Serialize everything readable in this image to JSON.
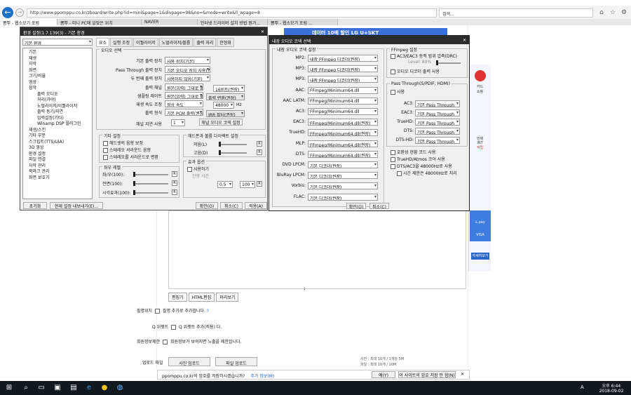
{
  "browser": {
    "url": "http://www.ppomppu.co.kr/zboard/write.php?id=mini&page=1&divpage=98&no=&mode=write&ll_wpage=8",
    "search": "검색...",
    "tabs": [
      "뽐뿌 - 웹소모기 포럼",
      "뽐뿌 - 미니 PC에 알맞은 위치",
      "NAVER",
      "인터넷 드라이버 설치 방법 뭔가...",
      "뽐뿌 - 웹소모기 포럼 ..."
    ]
  },
  "ad_top": "데이터 10배 할인 LG U+SKT",
  "editor_tabs": [
    "편집기",
    "HTML편집",
    "미리보기"
  ],
  "form": {
    "name_label": "필명위치",
    "name_check": "필명 추가로 추가합니다.",
    "help": "?",
    "chk_label": "Q 위젯트",
    "chk_text": "Q 위젯트 추가(적용) 다.",
    "anon_label": "회원정보제한",
    "anon_text": "회원정보가 보여지면 노출을 제한합니다.",
    "file_label": "업로드 파일",
    "file_btn1": "사진 업로드",
    "file_btn2": "파일 업로드",
    "quota1": "사진 : 최대 10개 / 1개당 5M",
    "quota2": "파일 : 최대 10개 / 10M"
  },
  "sidead": {
    "line1": "카드",
    "line2": "쇼핑",
    "line3": "언제",
    "line4": "INT",
    "line5": "적립",
    "lpay": "L.pay",
    "visa": "VISA",
    "detail": "자세히보기 >"
  },
  "main_dialog": {
    "title": "환경 설정(1.7.139(3) - 기본 환경",
    "tree_select": "기본 환경",
    "tree": [
      "기본",
      "재생",
      "자막",
      "화면",
      "크기/비율",
      "영상",
      "음악",
      "출력 오디오",
      "처리(가야)",
      "노멀라이저/이퀄라이저",
      "출력 동기/지연",
      "입력설정(기타)",
      "Winamp DSP 플러그인",
      "재생/스킨",
      "기타 부분",
      "스크립트(TTS/UIA)",
      "3D 영상",
      "환경 설정",
      "파일 연결",
      "자막 관리",
      "북마크 관리",
      "화면 보호기"
    ],
    "tabs": [
      "요소",
      "실행 조정",
      "이퀄라이저",
      "노멀라이저/볼륨",
      "출력 처리",
      "안정화"
    ],
    "g1": "오디오 선택",
    "rows": [
      {
        "l": "기본 출력 장치",
        "v": "사용 장치(기본)"
      },
      {
        "l": "Pass Through 출력 장치",
        "v": "기본 오디오 장치 사용(권장)"
      },
      {
        "l": "두 번째 출력 장치",
        "v": "사용하지 않음(기본)"
      },
      {
        "l": "출력 채널",
        "v": "원본(입력) 그대로 출력"
      },
      {
        "l": "샘플링 레이트",
        "v": "원본(입력) 그대로 출력"
      },
      {
        "l": "재생 속도 조정",
        "v": "정상 속도"
      },
      {
        "l": "출력 형식",
        "v": "기본 PCM 출력(권장)"
      }
    ],
    "bits": "16비트(권장)",
    "rate_extra": "48000",
    "ch_extra": "출력 변환(권장)",
    "play_extra": "IRR 필터(권장)",
    "delay_label": "채널 지연 사용",
    "delay_val": "1",
    "delay_btn": "채널 오디오 코덱 설정",
    "g2": "기타 설정",
    "g2_items": [
      "헤드셋의 음향 보정",
      "스테레오 서라운드 음향",
      "스테레오를 서라운드로 변환"
    ],
    "g3": "헤드폰과 볼륨 다이렉트 설정",
    "g3_a": "저음(L)",
    "g3_b": "고음(D)",
    "g4": "좌우 레벨",
    "g4_items": [
      "좌/우(100):",
      "전면(100):",
      "시각효과(100):"
    ],
    "g5": "효과 옵션",
    "g5_a": "사용하기",
    "g5_b": "잔향 시간",
    "g5_c": "0.5",
    "g5_d": "100",
    "btn_init": "초기화",
    "btn_save": "현재 설정 내보내기(E)...",
    "btn_ok": "확인(O)",
    "btn_cancel": "취소(C)",
    "btn_apply": "적용(A)"
  },
  "dec_dialog": {
    "title": "내장 오디오 코덱 선택",
    "g1": "내장 오디오 코덱 설정",
    "rows": [
      {
        "l": "MP2:",
        "v": "내장 FFmpeg 디코더(권장)"
      },
      {
        "l": "MP3:",
        "v": "내장 FFmpeg 디코더(권장)"
      },
      {
        "l": "MP3:",
        "v": "내장 FFmpeg 디코더(권장)"
      },
      {
        "l": "AAC:",
        "v": "FFmpeg/Minimum64.dll"
      },
      {
        "l": "AAC LATM:",
        "v": "FFmpeg/Minimum64.dll"
      },
      {
        "l": "AC3:",
        "v": "FFmpeg/Minimum64.dll"
      },
      {
        "l": "EAC3:",
        "v": "FFmpeg/Minimum64.dll(권장)"
      },
      {
        "l": "TrueHD:",
        "v": "FFmpeg/Minimum64.dll(권장)"
      },
      {
        "l": "MLP:",
        "v": "FFmpeg/Minimum64.dll(권장)"
      },
      {
        "l": "DTS:",
        "v": "FFmpeg/Minimum64.dll(권장)"
      },
      {
        "l": "DVD LPCM:",
        "v": "기본 디코더(권장)"
      },
      {
        "l": "BluRay LPCM:",
        "v": "기본 디코더(권장)"
      },
      {
        "l": "Vorbis:",
        "v": "기본 디코더(권장)"
      },
      {
        "l": "FLAC:",
        "v": "기본 디코더(권장)"
      }
    ],
    "g2": "FFmpeg 설정",
    "ff1": "AC3/EAC3 동적 범위 압축(DRC)",
    "ff_level": "Level: 80%",
    "ff2": "오디오 디코더 출력 사용",
    "g3": "Pass Through(S/PDIF, HDMI)",
    "pt_use": "사용",
    "pt": [
      {
        "l": "AC3:",
        "v": "기본 Pass Through"
      },
      {
        "l": "EAC3:",
        "v": "기본 Pass Through"
      },
      {
        "l": "TrueHD:",
        "v": "기본 Pass Through"
      },
      {
        "l": "DTS:",
        "v": "기본 Pass Through"
      },
      {
        "l": "DTS-HD:",
        "v": "기본 Pass Through"
      }
    ],
    "opts": [
      "호환성 현황 코드 사용",
      "TrueHD/Atmos 코어 사용",
      "DTS/AC3을 48000Hz로 사용",
      "시간 제한은 48000Hz로 처리"
    ],
    "ok": "확인(O)",
    "cancel": "취소(C)"
  },
  "infobar": {
    "text": "ppomppu.co.kr의 암호를 저장하시겠습니까?",
    "more": "추가 정보(M)",
    "yes": "예(Y)",
    "no": "이 사이트의 암호 저장 안 함(N)"
  },
  "taskbar": {
    "time": "오후 6:44",
    "date": "2018-09-02",
    "lang": "A"
  }
}
